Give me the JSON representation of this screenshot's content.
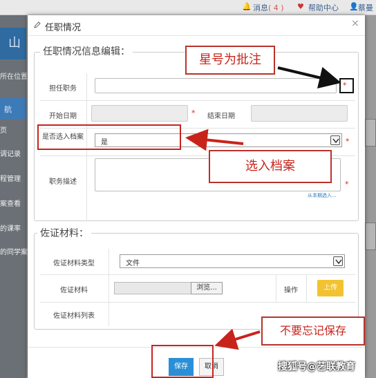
{
  "topbar": {
    "messages_label": "消息",
    "messages_count": "( 4 )",
    "help_label": "帮助中心",
    "user_label": "蔡曼"
  },
  "background": {
    "logo_text": "山",
    "breadcrumb": "所在位置",
    "nav_title": "航",
    "menu": [
      "页",
      "调记录",
      "程管理",
      "案查看",
      "的课率",
      "的同学案"
    ]
  },
  "dialog": {
    "title": "任职情况",
    "close": "×",
    "section1": {
      "legend": "任职情况信息编辑：",
      "position_label": "担任职务",
      "start_label": "开始日期",
      "end_label": "结束日期",
      "archive_label": "是否选入档案",
      "archive_value": "是",
      "desc_label": "职务描述",
      "desc_link": "从本期选入...",
      "required_mark": "*"
    },
    "section2": {
      "legend": "佐证材料：",
      "type_label": "佐证材料类型",
      "type_value": "文件",
      "material_label": "佐证材料",
      "browse_label": "浏览...",
      "op_label": "操作",
      "upload_label": "上传",
      "list_label": "佐证材料列表"
    },
    "save_label": "保存",
    "cancel_label": "取消"
  },
  "annotations": {
    "star_note": "星号为批注",
    "archive_note": "选入档案",
    "save_note": "不要忘记保存",
    "accent_color": "#c8231b"
  },
  "watermark": "搜狐号@艺联教育"
}
